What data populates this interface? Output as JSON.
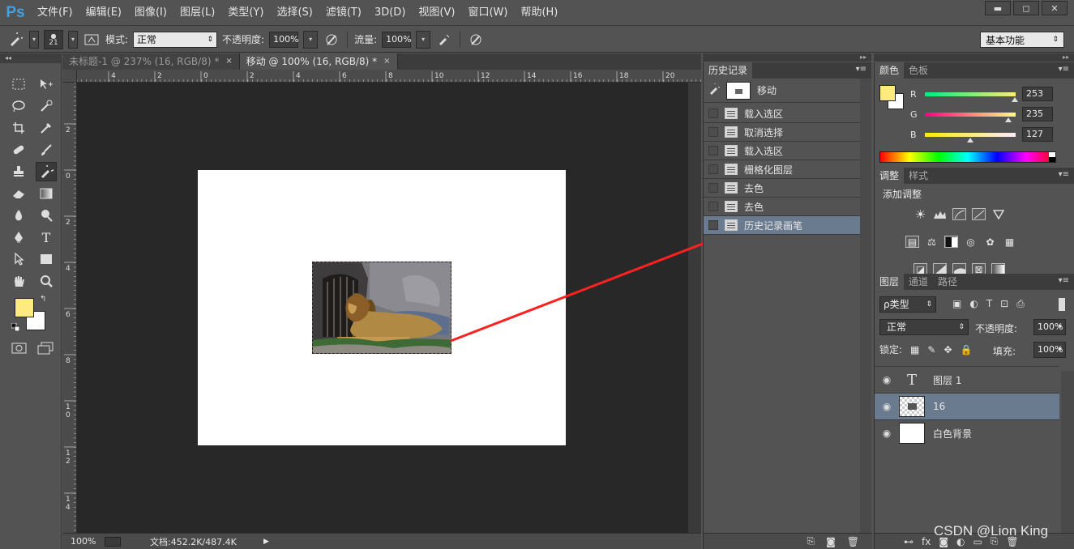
{
  "app": {
    "logo": "Ps",
    "menu": [
      "文件(F)",
      "编辑(E)",
      "图像(I)",
      "图层(L)",
      "类型(Y)",
      "选择(S)",
      "滤镜(T)",
      "3D(D)",
      "视图(V)",
      "窗口(W)",
      "帮助(H)"
    ],
    "window_controls": [
      "▬",
      "◻",
      "✕"
    ]
  },
  "options": {
    "brush_size": "21",
    "mode_label": "模式:",
    "mode_value": "正常",
    "opacity_label": "不透明度:",
    "opacity_value": "100%",
    "flow_label": "流量:",
    "flow_value": "100%",
    "workspace": "基本功能"
  },
  "documents": {
    "tabs": [
      {
        "label": "未标题-1 @ 237% (16, RGB/8) *",
        "active": false
      },
      {
        "label": "移动 @ 100% (16, RGB/8) *",
        "active": true
      }
    ],
    "close_glyph": "×"
  },
  "rulers": {
    "top": [
      "4",
      "2",
      "0",
      "2",
      "4",
      "6",
      "8",
      "10",
      "12",
      "14",
      "16",
      "18",
      "20"
    ],
    "left": [
      "2",
      "0",
      "2",
      "4",
      "6",
      "8",
      "1 0",
      "1 2",
      "1 4"
    ]
  },
  "statusbar": {
    "zoom": "100%",
    "doc_info": "文档:452.2K/487.4K"
  },
  "history": {
    "tab": "历史记录",
    "snapshot_label": "移动",
    "items": [
      {
        "label": "载入选区",
        "selected": false
      },
      {
        "label": "取消选择",
        "selected": false
      },
      {
        "label": "载入选区",
        "selected": false
      },
      {
        "label": "栅格化图层",
        "selected": false
      },
      {
        "label": "去色",
        "selected": false
      },
      {
        "label": "去色",
        "selected": false
      },
      {
        "label": "历史记录画笔",
        "selected": true
      }
    ]
  },
  "color_panel": {
    "tabs": [
      "颜色",
      "色板"
    ],
    "fg_color": "#fdeb7f",
    "bg_color": "#ffffff",
    "channels": [
      {
        "label": "R",
        "value": "253",
        "fraction": 0.99
      },
      {
        "label": "G",
        "value": "235",
        "fraction": 0.92
      },
      {
        "label": "B",
        "value": "127",
        "fraction": 0.5
      }
    ]
  },
  "adjustments": {
    "tabs": [
      "调整",
      "样式"
    ],
    "title": "添加调整"
  },
  "layers": {
    "tabs": [
      "图层",
      "通道",
      "路径"
    ],
    "filter": "ρ类型",
    "blend_mode": "正常",
    "opacity_label": "不透明度:",
    "opacity_value": "100%",
    "lock_label": "锁定:",
    "fill_label": "填充:",
    "fill_value": "100%",
    "items": [
      {
        "name": "图层 1",
        "type": "text",
        "selected": false
      },
      {
        "name": "16",
        "type": "image",
        "selected": true
      },
      {
        "name": "白色背景",
        "type": "white",
        "selected": false
      }
    ]
  },
  "watermark": "CSDN @Lion King",
  "accent_colors": {
    "selection": "#6a7b90",
    "arrow": "#ff2020",
    "ps_logo": "#3fa0e6"
  }
}
